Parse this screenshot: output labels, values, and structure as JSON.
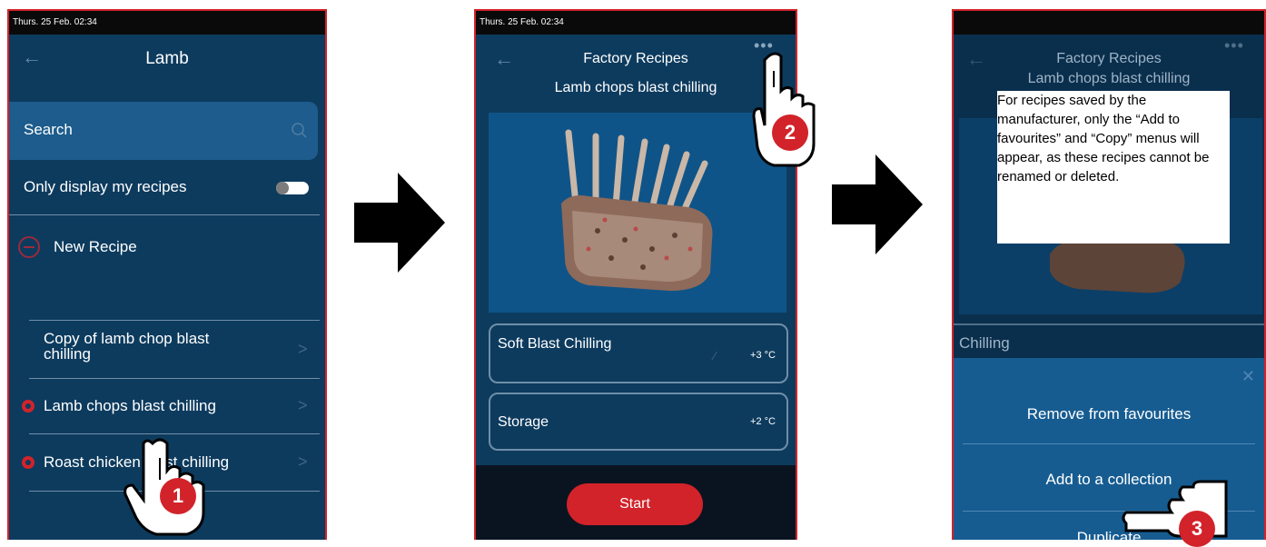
{
  "screen1": {
    "status_time": "Thurs. 25 Feb. 02:34",
    "title": "Lamb",
    "search_label": "Search",
    "only_mine_label": "Only display my recipes",
    "new_recipe_label": "New Recipe",
    "recipes": [
      {
        "label": "Copy of lamb chop blast chilling"
      },
      {
        "label": "Lamb chops blast chilling"
      },
      {
        "label": "Roast chicken blast chilling"
      }
    ],
    "step_badge": "1"
  },
  "screen2": {
    "status_time": "Thurs. 25 Feb. 02:34",
    "title": "Factory Recipes",
    "subtitle": "Lamb chops blast chilling",
    "phases": [
      {
        "label": "Soft Blast Chilling",
        "temp": "+3 °C"
      },
      {
        "label": "Storage",
        "temp": "+2 °C"
      }
    ],
    "start_label": "Start",
    "step_badge": "2"
  },
  "screen3": {
    "title": "Factory Recipes",
    "subtitle": "Lamb chops blast chilling",
    "note": "For recipes saved by the manufacturer, only the “Add to favourites” and “Copy” menus will appear, as these recipes cannot be renamed or deleted.",
    "phase_partial": "Chilling",
    "menu_items": [
      {
        "label": "Remove from favourites"
      },
      {
        "label": "Add to a collection"
      },
      {
        "label": "Duplicate"
      }
    ],
    "step_badge": "3"
  },
  "icons": {
    "back": "back-arrow-icon",
    "search": "search-icon",
    "chevron": "chevron-right-icon",
    "more": "more-dots-icon",
    "hand": "pointing-hand-icon",
    "flow_arrow": "arrow-right-icon"
  },
  "colors": {
    "screen_bg": "#0d3b5e",
    "accent_red": "#d2232a",
    "search_bg": "#1d5c8c",
    "menu_bg": "#165c91"
  }
}
